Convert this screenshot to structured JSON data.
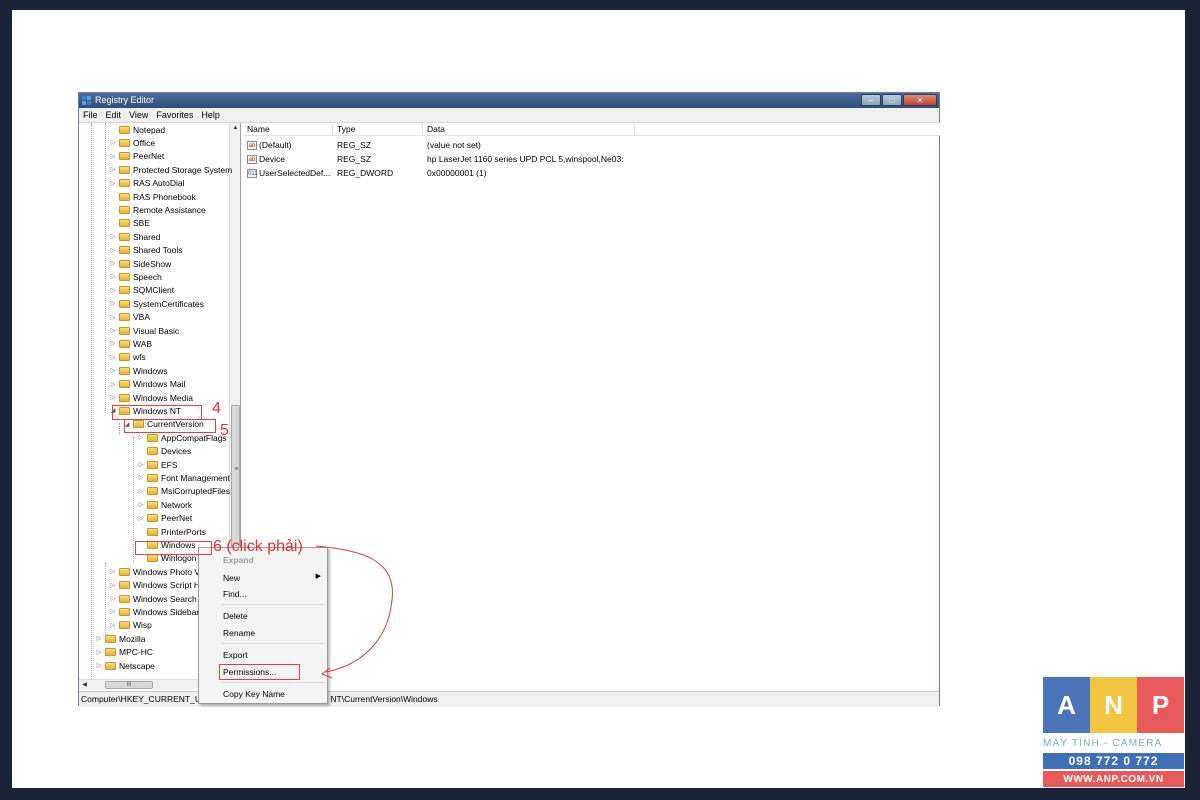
{
  "window": {
    "title": "Registry Editor",
    "menu": [
      "File",
      "Edit",
      "View",
      "Favorites",
      "Help"
    ],
    "buttons": {
      "minimize": "–",
      "maximize": "□",
      "close": "✕"
    }
  },
  "tree": {
    "top_items": [
      "Notepad",
      "Office",
      "PeerNet",
      "Protected Storage System",
      "RAS AutoDial",
      "RAS Phonebook",
      "Remote Assistance",
      "SBE",
      "Shared",
      "Shared Tools",
      "SideShow",
      "Speech",
      "SQMClient",
      "SystemCertificates",
      "VBA",
      "Visual Basic",
      "WAB",
      "wfs",
      "Windows",
      "Windows Mail",
      "Windows Media"
    ],
    "windows_nt": "Windows NT",
    "current_version": "CurrentVersion",
    "cv_children": [
      "AppCompatFlags",
      "Devices",
      "EFS",
      "Font Management",
      "MsiCorruptedFiles",
      "Network",
      "PeerNet",
      "PrinterPorts",
      "Windows",
      "Winlogon"
    ],
    "after_items": [
      "Windows Photo Viewer",
      "Windows Script Host",
      "Windows Search",
      "Windows Sidebar",
      "Wisp"
    ],
    "root_items": [
      "Mozilla",
      "MPC-HC",
      "Netscape"
    ],
    "hscroll_grip": "III",
    "vscroll_grip": "≡"
  },
  "list": {
    "columns": [
      "Name",
      "Type",
      "Data"
    ],
    "rows": [
      {
        "icon": "ab",
        "name": "(Default)",
        "type": "REG_SZ",
        "data": "(value not set)"
      },
      {
        "icon": "ab",
        "name": "Device",
        "type": "REG_SZ",
        "data": "hp LaserJet 1160 series UPD PCL 5,winspool,Ne03:"
      },
      {
        "icon": "011",
        "name": "UserSelectedDef...",
        "type": "REG_DWORD",
        "data": "0x00000001 (1)"
      }
    ]
  },
  "status": {
    "path": "Computer\\HKEY_CURRENT_USER\\Software\\Microsoft\\Windows NT\\CurrentVersion\\Windows"
  },
  "context_menu": {
    "expand": "Expand",
    "new": "New",
    "find": "Find...",
    "delete": "Delete",
    "rename": "Rename",
    "export": "Export",
    "permissions": "Permissions...",
    "copy_key_name": "Copy Key Name"
  },
  "annotations": {
    "step4": "4",
    "step5": "5",
    "step6": "6 (click phải)"
  },
  "logo": {
    "letters": [
      "A",
      "N",
      "P"
    ],
    "tile_colors": [
      "#4b73b8",
      "#f4c542",
      "#e85a5a"
    ],
    "line1": "MÁY TÍNH - CAMERA",
    "phone": "098 772 0 772",
    "url": "WWW.ANP.COM.VN"
  }
}
